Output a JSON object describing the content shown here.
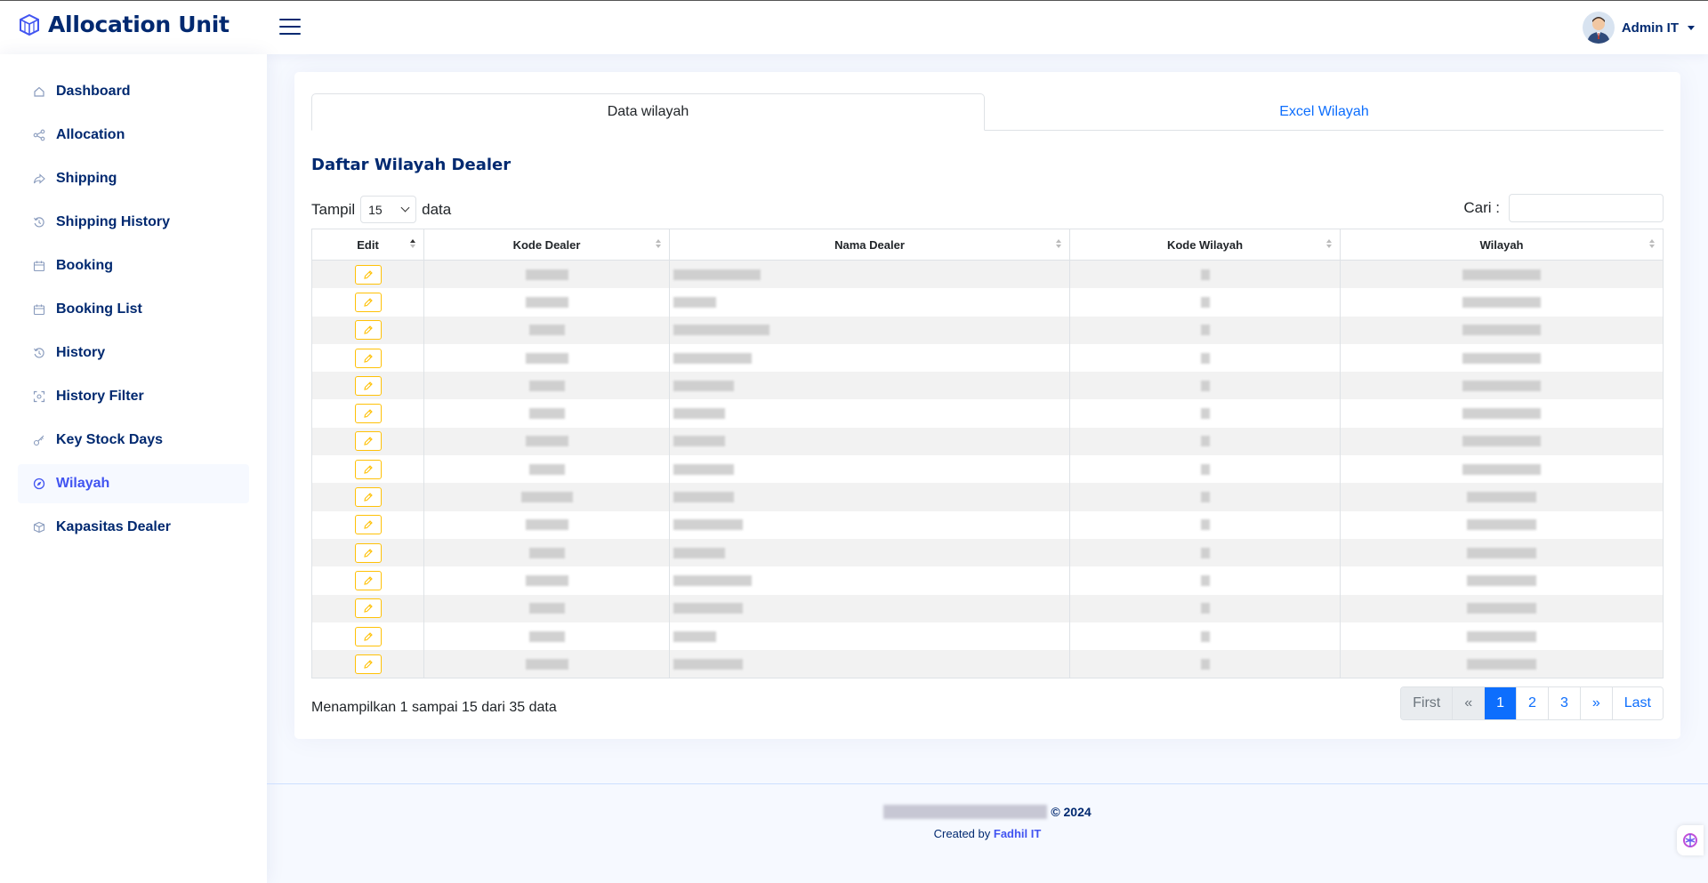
{
  "header": {
    "app_title": "Allocation Unit",
    "user_name": "Admin IT"
  },
  "sidebar": {
    "items": [
      {
        "label": "Dashboard",
        "icon": "house-icon"
      },
      {
        "label": "Allocation",
        "icon": "share-icon"
      },
      {
        "label": "Shipping",
        "icon": "forward-icon"
      },
      {
        "label": "Shipping History",
        "icon": "history-icon"
      },
      {
        "label": "Booking",
        "icon": "calendar-icon"
      },
      {
        "label": "Booking List",
        "icon": "calendar-icon"
      },
      {
        "label": "History",
        "icon": "history-icon"
      },
      {
        "label": "History Filter",
        "icon": "filter-frame-icon"
      },
      {
        "label": "Key Stock Days",
        "icon": "key-icon"
      },
      {
        "label": "Wilayah",
        "icon": "compass-icon",
        "active": true
      },
      {
        "label": "Kapasitas Dealer",
        "icon": "box-icon"
      }
    ]
  },
  "tabs": {
    "data_wilayah": "Data wilayah",
    "excel_wilayah": "Excel Wilayah"
  },
  "card": {
    "title": "Daftar Wilayah Dealer",
    "length_prefix": "Tampil",
    "length_value": "15",
    "length_suffix": "data",
    "search_label": "Cari :"
  },
  "table": {
    "columns": [
      "Edit",
      "Kode Dealer",
      "Nama Dealer",
      "Kode Wilayah",
      "Wilayah"
    ],
    "row_count": 15
  },
  "info_text": "Menampilkan 1 sampai 15 dari 35 data",
  "pagination": {
    "first": "First",
    "prev": "«",
    "pages": [
      "1",
      "2",
      "3"
    ],
    "current": "1",
    "next": "»",
    "last": "Last"
  },
  "footer": {
    "year": "© 2024",
    "created_by_prefix": "Created by",
    "created_by_name": "Fadhil IT"
  },
  "colors": {
    "brand": "#012970",
    "accent": "#4154f1",
    "link": "#0d6efd",
    "edit_border": "#ffc107"
  }
}
